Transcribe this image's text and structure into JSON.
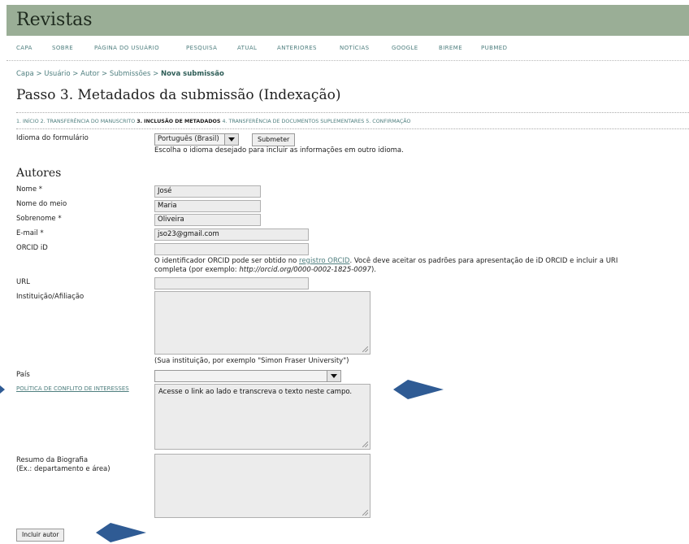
{
  "site": {
    "title": "Revistas"
  },
  "nav": [
    "CAPA",
    "SOBRE",
    "PÁGINA DO USUÁRIO",
    "PESQUISA",
    "ATUAL",
    "ANTERIORES",
    "NOTÍCIAS",
    "GOOGLE",
    "BIREME",
    "PUBMED"
  ],
  "breadcrumb": {
    "items": [
      "Capa",
      "Usuário",
      "Autor",
      "Submissões"
    ],
    "separator": " > ",
    "current": "Nova submissão"
  },
  "page_title": "Passo 3. Metadados da submissão (Indexação)",
  "steps": [
    {
      "label": "1. INÍCIO",
      "active": false
    },
    {
      "label": "2. TRANSFERÊNCIA DO MANUSCRITO",
      "active": false
    },
    {
      "label": "3. INCLUSÃO DE METADADOS",
      "active": true
    },
    {
      "label": "4. TRANSFERÊNCIA DE DOCUMENTOS SUPLEMENTARES",
      "active": false
    },
    {
      "label": "5. CONFIRMAÇÃO",
      "active": false
    }
  ],
  "form_language": {
    "label": "Idioma do formulário",
    "selected": "Português (Brasil)",
    "submit_label": "Submeter",
    "help": "Escolha o idioma desejado para incluir as informações em outro idioma."
  },
  "authors": {
    "heading": "Autores",
    "first_name": {
      "label": "Nome *",
      "value": "José"
    },
    "middle_name": {
      "label": "Nome do meio",
      "value": "Maria"
    },
    "last_name": {
      "label": "Sobrenome *",
      "value": "Oliveira"
    },
    "email": {
      "label": "E-mail *",
      "value": "jso23@gmail.com"
    },
    "orcid": {
      "label": "ORCID iD",
      "value": "",
      "help_prefix": "O identificador ORCID pode ser obtido no ",
      "help_link": "registro ORCID",
      "help_middle": ". Você deve aceitar os padrões para apresentação de iD ORCID e incluir a URI",
      "help_line2_prefix": "completa (por exemplo: ",
      "help_example": "http://orcid.org/0000-0002-1825-0097",
      "help_line2_suffix": ")."
    },
    "url": {
      "label": "URL",
      "value": ""
    },
    "affiliation": {
      "label": "Instituição/Afiliação",
      "value": "",
      "help": "(Sua instituição, por exemplo \"Simon Fraser University\")"
    },
    "country": {
      "label": "País",
      "selected": ""
    },
    "conflict": {
      "label": "POLÍTICA DE CONFLITO DE INTERESSES",
      "value": "Acesse o link ao lado e transcreva o texto neste campo."
    },
    "bio": {
      "label_line1": "Resumo da Biografia",
      "label_line2": "(Ex.: departamento e área)",
      "value": ""
    },
    "add_author_label": "Incluir autor"
  },
  "annotation_color": "#2f5b94"
}
